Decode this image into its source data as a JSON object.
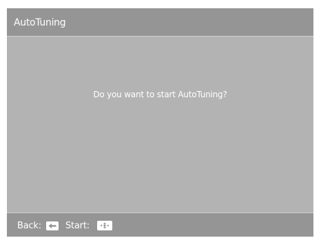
{
  "dialog": {
    "title": "AutoTuning",
    "message": "Do you want to start AutoTuning?"
  },
  "footer": {
    "back_label": "Back:",
    "back_icon": "back-arrow-icon",
    "start_label": "Start:",
    "start_icon": "ok-center-icon"
  },
  "colors": {
    "header_bg": "#959595",
    "body_bg": "#b3b3b3",
    "text": "#ffffff"
  }
}
